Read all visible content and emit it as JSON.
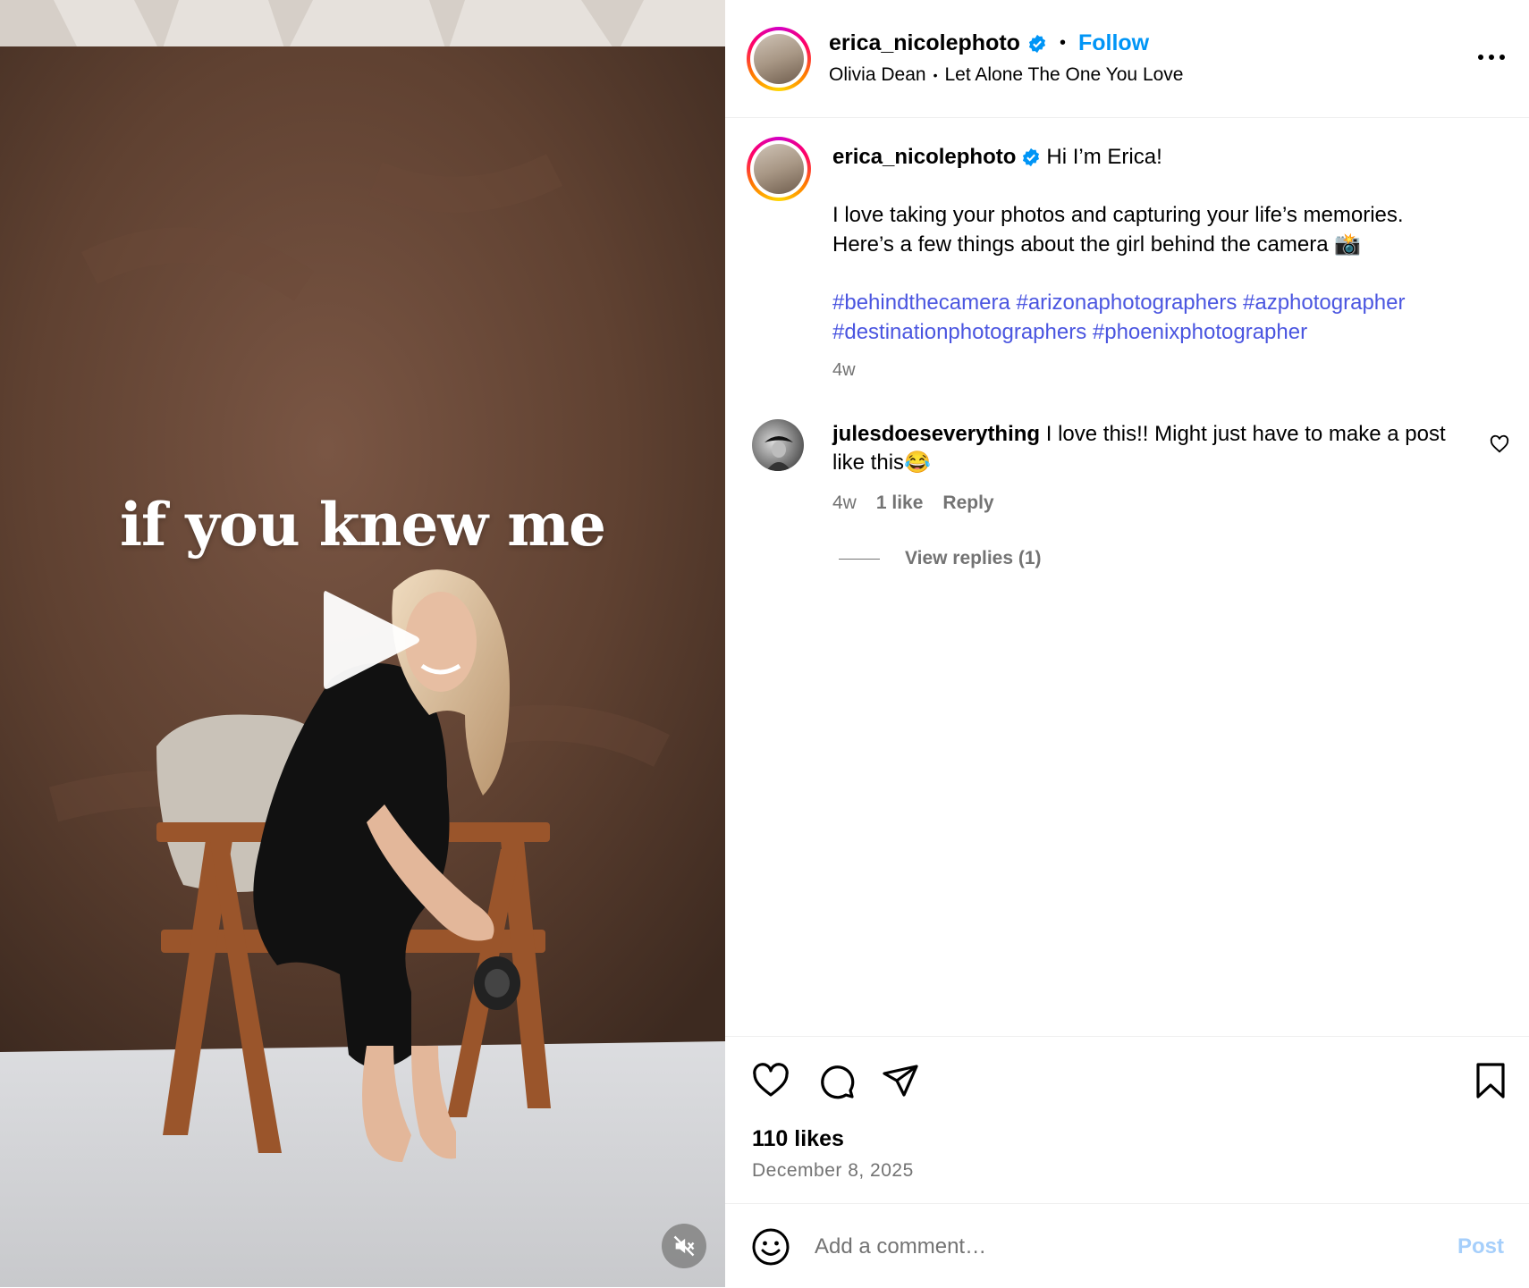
{
  "post": {
    "author": "erica_nicolephoto",
    "follow_label": "Follow",
    "music_artist": "Olivia Dean",
    "music_track": "Let Alone The One You Love",
    "separator": "•"
  },
  "media": {
    "overlay_text": "if you knew me",
    "icons": {
      "play": "play-icon",
      "mute": "volume-muted-icon"
    }
  },
  "caption": {
    "author": "erica_nicolephoto",
    "greeting": "Hi I’m Erica!",
    "line1": "I love taking your photos and capturing your life’s memories.",
    "line2": "Here’s a few things about the girl behind the camera 📸",
    "hashtags": [
      "#behindthecamera",
      "#arizonaphotographers",
      "#azphotographer",
      "#destinationphotographers",
      "#phoenixphotographer"
    ],
    "time": "4w"
  },
  "comments": [
    {
      "author": "julesdoeseverything",
      "text": "I love this!! Might just have to make a post like this😂",
      "time": "4w",
      "likes": "1 like",
      "reply_label": "Reply",
      "view_replies": "View replies (1)"
    }
  ],
  "stats": {
    "likes": "110 likes",
    "date": "December 8, 2025"
  },
  "comment_box": {
    "placeholder": "Add a comment…",
    "post_label": "Post"
  },
  "colors": {
    "follow": "#0095f6",
    "hashtag": "#4a55e0",
    "muted_text": "#737373",
    "post_disabled": "#a6cffb",
    "verified": "#0095f6"
  }
}
